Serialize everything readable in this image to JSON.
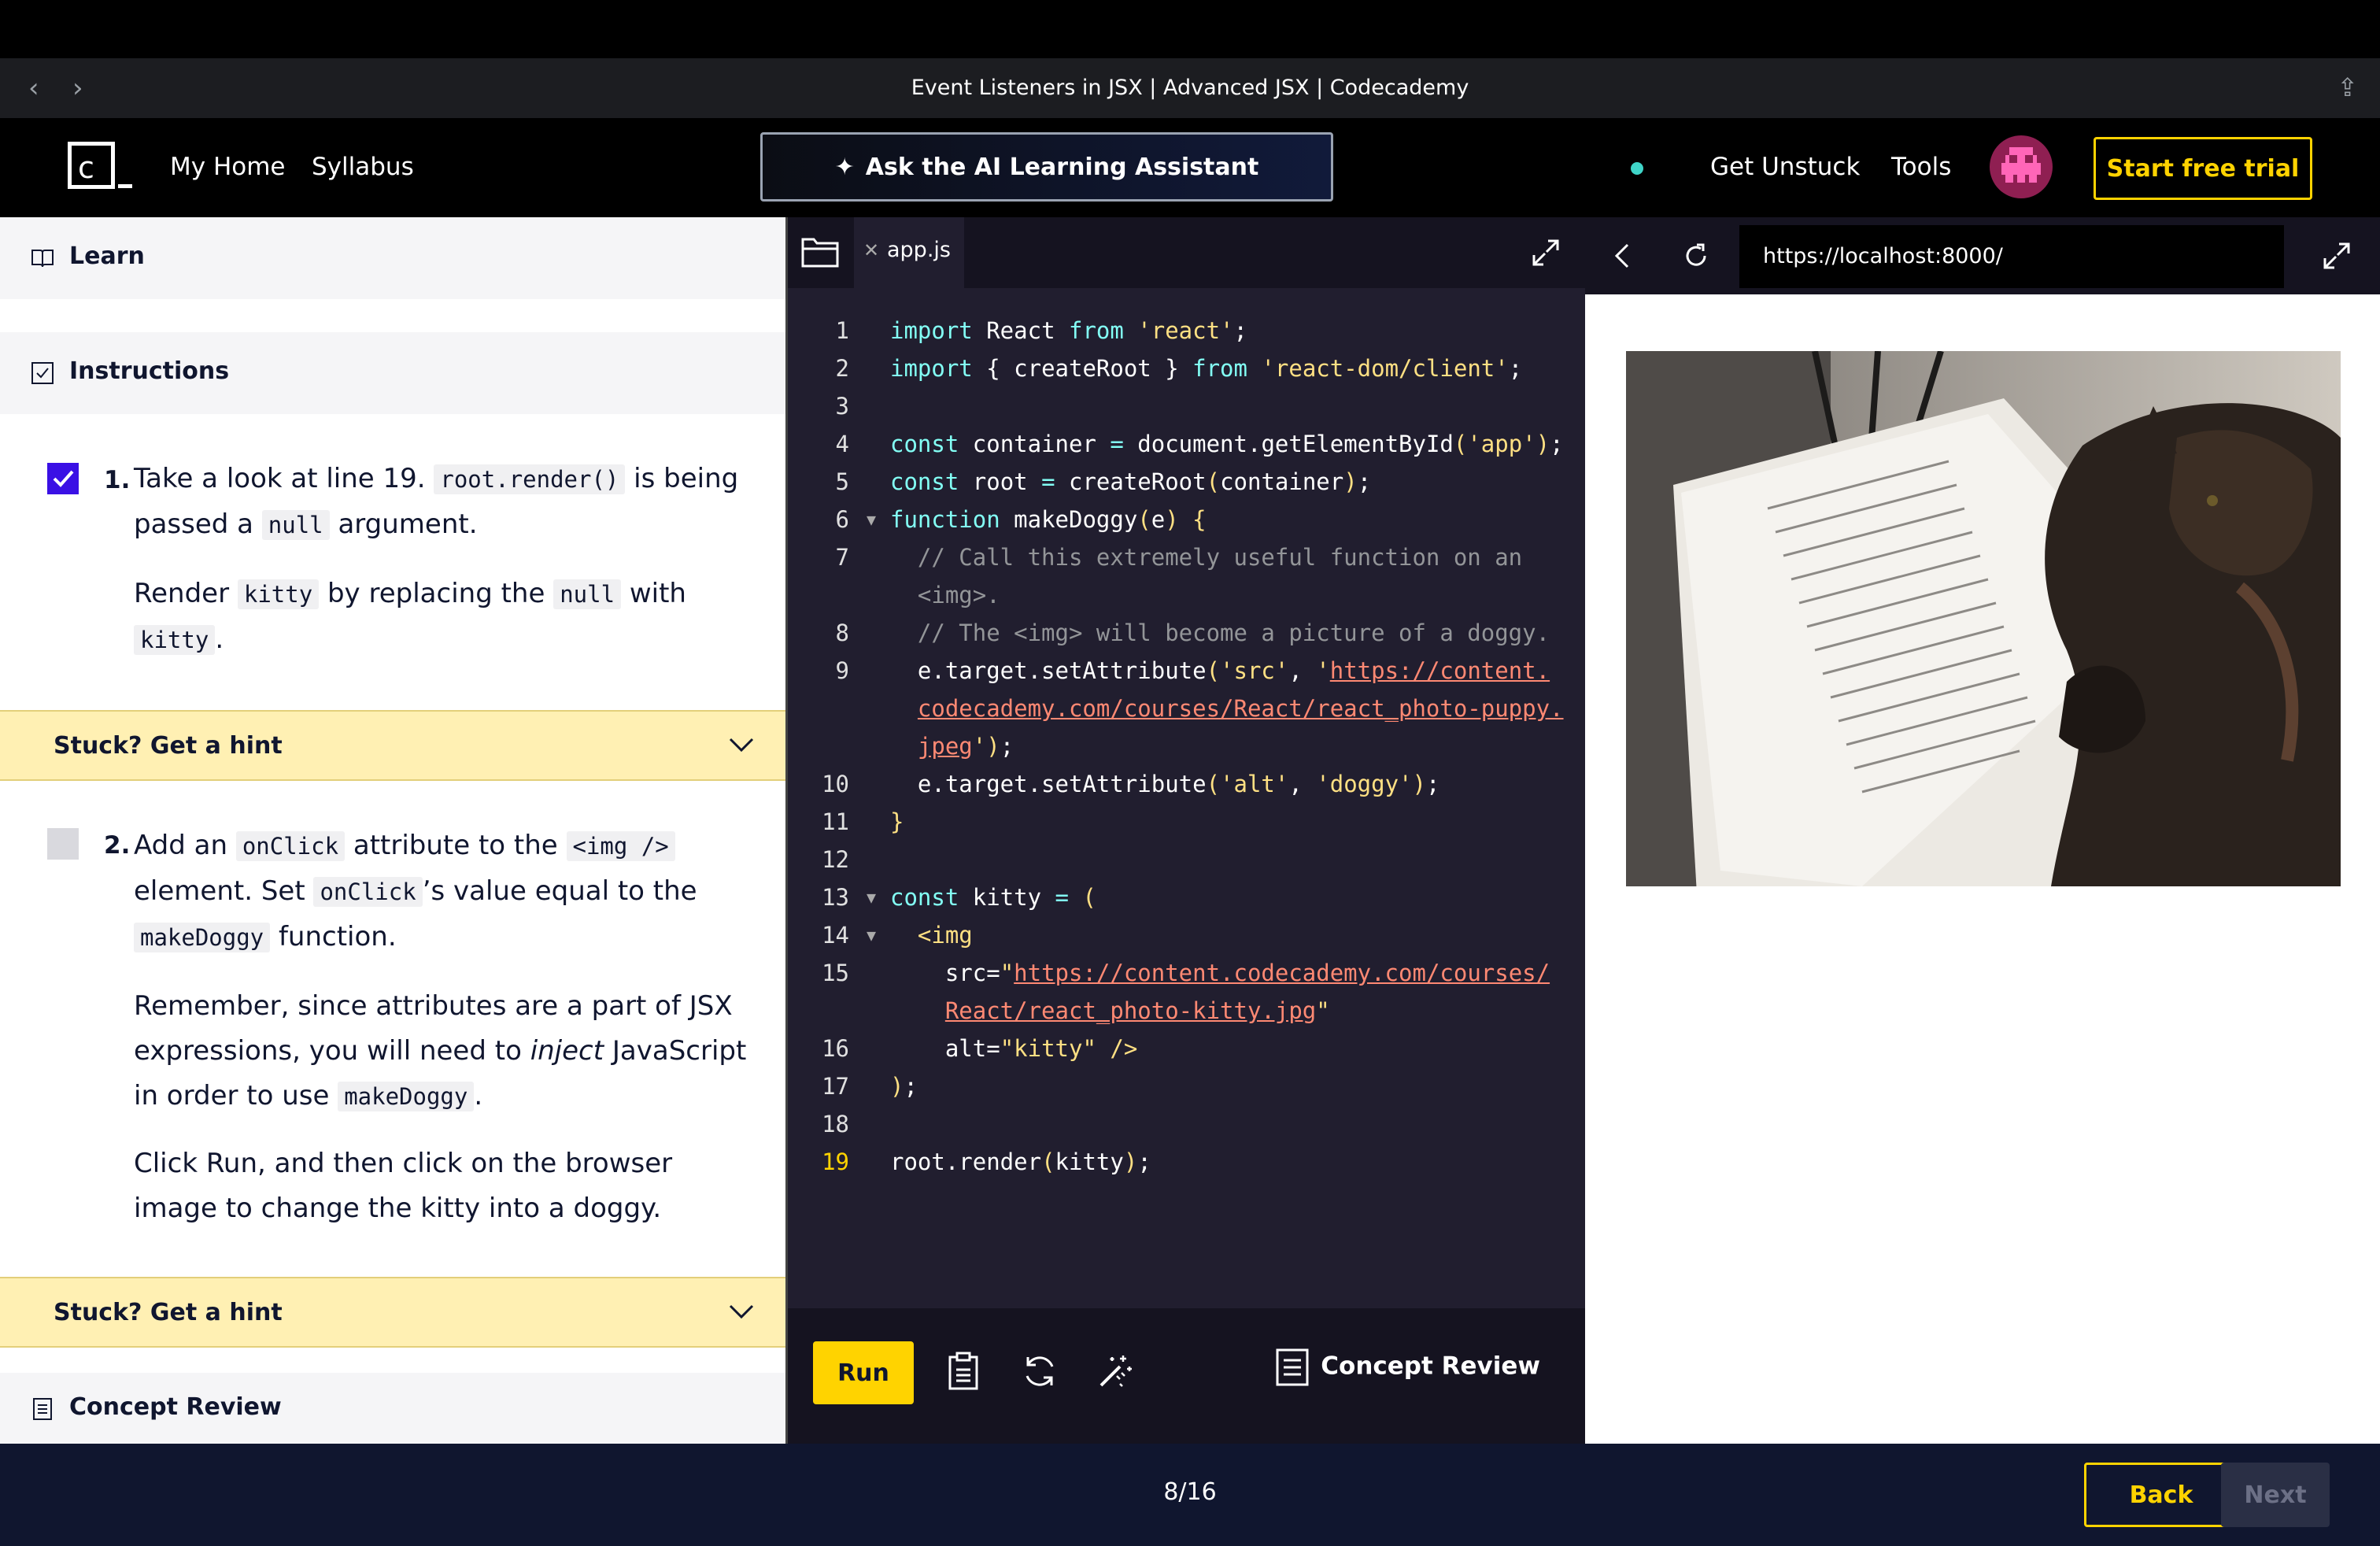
{
  "window": {
    "title": "Event Listeners in JSX | Advanced JSX | Codecademy"
  },
  "header": {
    "logo_letter": "c",
    "nav": [
      "My Home",
      "Syllabus"
    ],
    "ai_button": "Ask the AI Learning Assistant",
    "get_unstuck": "Get Unstuck",
    "tools": "Tools",
    "trial_button": "Start free trial"
  },
  "left": {
    "learn_label": "Learn",
    "instructions_label": "Instructions",
    "tasks": [
      {
        "number": "1.",
        "checked": true,
        "p1": [
          "Take a look at line 19. ",
          "root.render()",
          " is being passed a ",
          "null",
          " argument."
        ],
        "p2": [
          "Render ",
          "kitty",
          " by replacing the ",
          "null",
          " with ",
          "kitty",
          "."
        ]
      },
      {
        "number": "2.",
        "checked": false,
        "p1": [
          "Add an ",
          "onClick",
          " attribute to the ",
          "<img />",
          " element. Set ",
          "onClick",
          "’s value equal to the ",
          "makeDoggy",
          " function."
        ],
        "p2": [
          "Remember, since attributes are a part of JSX expressions, you will need to ",
          "inject",
          " JavaScript in order to use ",
          "makeDoggy",
          "."
        ],
        "p3": "Click Run, and then click on the browser image to change the kitty into a doggy."
      }
    ],
    "hint_label": "Stuck? Get a hint",
    "concept_review": "Concept Review"
  },
  "editor": {
    "file_tab": "app.js",
    "run_button": "Run",
    "concept_review": "Concept Review",
    "current_line": "19",
    "lines": [
      {
        "n": "1",
        "t": "import React from 'react';"
      },
      {
        "n": "2",
        "t": "import { createRoot } from 'react-dom/client';"
      },
      {
        "n": "3",
        "t": ""
      },
      {
        "n": "4",
        "t": "const container = document.getElementById('app');"
      },
      {
        "n": "5",
        "t": "const root = createRoot(container);"
      },
      {
        "n": "6",
        "t": "function makeDoggy(e) {"
      },
      {
        "n": "7",
        "t": "// Call this extremely useful function on an <img>."
      },
      {
        "n": "8",
        "t": "// The <img> will become a picture of a doggy."
      },
      {
        "n": "9",
        "t": "e.target.setAttribute('src', 'https://content.codecademy.com/courses/React/react_photo-puppy.jpeg');"
      },
      {
        "n": "10",
        "t": "e.target.setAttribute('alt', 'doggy');"
      },
      {
        "n": "11",
        "t": "}"
      },
      {
        "n": "12",
        "t": ""
      },
      {
        "n": "13",
        "t": "const kitty = ("
      },
      {
        "n": "14",
        "t": "<img"
      },
      {
        "n": "15",
        "t": "src=\"https://content.codecademy.com/courses/React/react_photo-kitty.jpg\""
      },
      {
        "n": "16",
        "t": "alt=\"kitty\" />"
      },
      {
        "n": "17",
        "t": ");"
      },
      {
        "n": "18",
        "t": ""
      },
      {
        "n": "19",
        "t": "root.render(kitty);"
      }
    ]
  },
  "browser": {
    "url": "https://localhost:8000/"
  },
  "footer": {
    "progress": "8/16",
    "back": "Back",
    "next": "Next"
  }
}
